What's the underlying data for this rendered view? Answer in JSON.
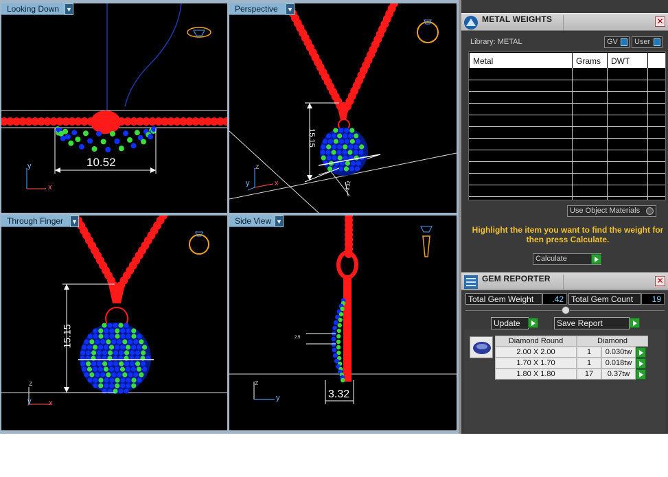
{
  "viewports": [
    {
      "label": "Looking Down",
      "dimension": "10.52",
      "axes": [
        "y",
        "x"
      ]
    },
    {
      "label": "Perspective",
      "dimension": "15.15",
      "small_dim": "3.32",
      "axes": [
        "z",
        "y",
        "x"
      ]
    },
    {
      "label": "Through Finger",
      "dimension": "15.15",
      "axes": [
        "z",
        "y",
        "x"
      ]
    },
    {
      "label": "Side View",
      "dimension": "3.32",
      "small_dim": "2.5",
      "axes": [
        "z",
        "y"
      ]
    }
  ],
  "metal_weights": {
    "title": "METAL WEIGHTS",
    "library": "Library: METAL",
    "gv_label": "GV",
    "user_label": "User",
    "columns": [
      "Metal",
      "Grams",
      "DWT"
    ],
    "use_object_materials": "Use Object Materials",
    "hint": "Highlight the item you want to find the weight for then press Calculate.",
    "calculate": "Calculate"
  },
  "gem_reporter": {
    "title": "GEM REPORTER",
    "total_weight_label": "Total Gem Weight",
    "total_weight": ".42",
    "total_count_label": "Total Gem Count",
    "total_count": "19",
    "update": "Update",
    "save_report": "Save Report",
    "header": [
      "Diamond Round",
      "Diamond"
    ],
    "rows": [
      {
        "size": "2.00 X 2.00",
        "count": "1",
        "weight": "0.030tw"
      },
      {
        "size": "1.70 X 1.70",
        "count": "1",
        "weight": "0.018tw"
      },
      {
        "size": "1.80 X 1.80",
        "count": "17",
        "weight": "0.37tw"
      }
    ]
  },
  "colors": {
    "metal": "#ff1a1a",
    "gem_blue": "#1030ff",
    "gem_green": "#3ddc3d",
    "dim_line": "#ffffff",
    "accent_yellow": "#f2c230"
  }
}
